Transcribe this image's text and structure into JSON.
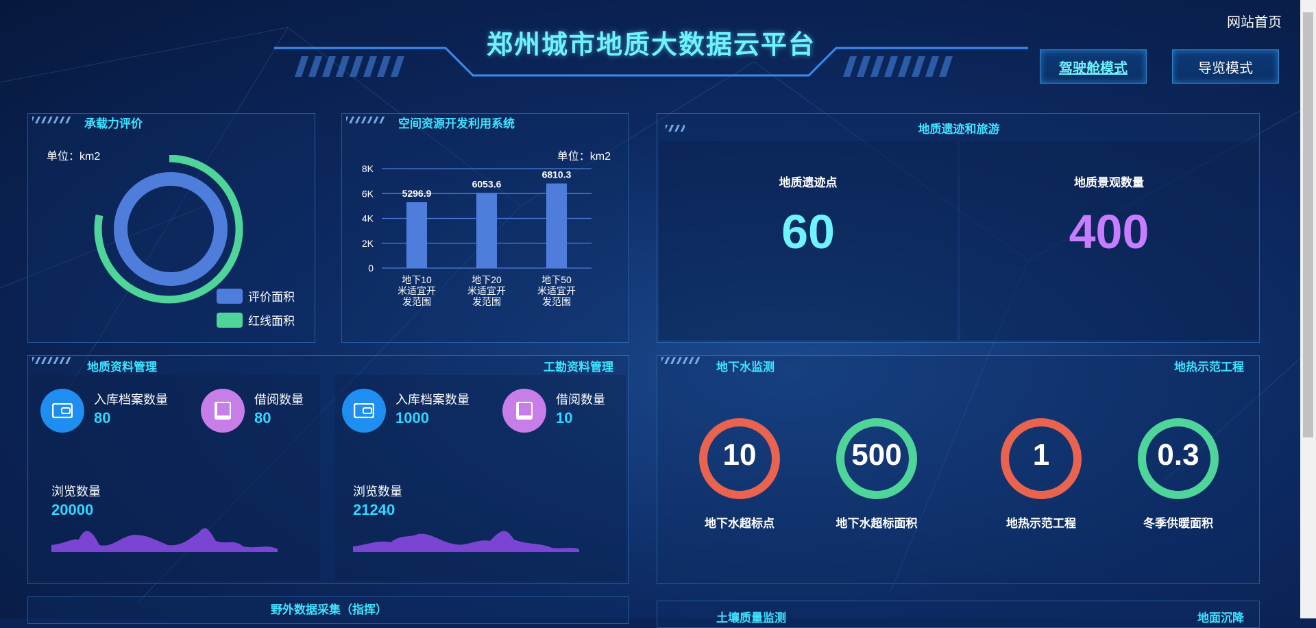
{
  "header": {
    "title": "郑州城市地质大数据云平台",
    "home_link": "网站首页",
    "modes": [
      "驾驶舱模式",
      "导览模式"
    ]
  },
  "capacity_panel": {
    "title": "承载力评价",
    "unit": "单位：km2",
    "legend": [
      "评价面积",
      "红线面积"
    ],
    "colors": {
      "eval": "#4f7ddb",
      "red_line": "#4fd49a"
    }
  },
  "space_panel": {
    "title": "空间资源开发利用系统",
    "unit": "单位：km2"
  },
  "chart_data": {
    "type": "bar",
    "categories": [
      "地下10米适宜开发范围",
      "地下20米适宜开发范围",
      "地下50米适宜开发范围"
    ],
    "category_lines": [
      [
        "地下10",
        "米适宜开",
        "发范围"
      ],
      [
        "地下20",
        "米适宜开",
        "发范围"
      ],
      [
        "地下50",
        "米适宜开",
        "发范围"
      ]
    ],
    "values": [
      5296.9,
      6053.6,
      6810.3
    ],
    "value_labels": [
      "5296.9",
      "6053.6",
      "6810.3"
    ],
    "yticks": [
      "0",
      "2K",
      "4K",
      "6K",
      "8K"
    ],
    "ylim": [
      0,
      8000
    ],
    "grid": true,
    "color": "#4f7ddb"
  },
  "geo_tour_panel": {
    "title": "地质遗迹和旅游",
    "items": [
      {
        "label": "地质遗迹点",
        "value": "60",
        "color": "#6ff3ff"
      },
      {
        "label": "地质景观数量",
        "value": "400",
        "color": "#c77dff"
      }
    ]
  },
  "records_panel": {
    "title_left": "地质资料管理",
    "title_right": "工勘资料管理",
    "cards": [
      {
        "stats": [
          {
            "name": "入库档案数量",
            "value": "80",
            "icon": "wallet-icon"
          },
          {
            "name": "借阅数量",
            "value": "80",
            "icon": "book-icon"
          }
        ],
        "browse_label": "浏览数量",
        "browse_value": "20000"
      },
      {
        "stats": [
          {
            "name": "入库档案数量",
            "value": "1000",
            "icon": "wallet-icon"
          },
          {
            "name": "借阅数量",
            "value": "10",
            "icon": "book-icon"
          }
        ],
        "browse_label": "浏览数量",
        "browse_value": "21240"
      }
    ],
    "colors": {
      "wallet": "#1e8ff0",
      "book": "#c77ee8",
      "sparkline": "#7b45d4"
    }
  },
  "water_panel": {
    "title_left": "地下水监测",
    "title_right": "地热示范工程",
    "rings": [
      {
        "value": "10",
        "label": "地下水超标点",
        "color": "#e9634f"
      },
      {
        "value": "500",
        "label": "地下水超标面积",
        "color": "#4fd49a"
      },
      {
        "value": "1",
        "label": "地热示范工程",
        "color": "#e9634f"
      },
      {
        "value": "0.3",
        "label": "冬季供暖面积",
        "color": "#4fd49a"
      }
    ]
  },
  "bottom_panels": {
    "field_title": "野外数据采集（指挥）",
    "soil_title": "土壤质量监测",
    "subsidence_title": "地面沉降"
  }
}
